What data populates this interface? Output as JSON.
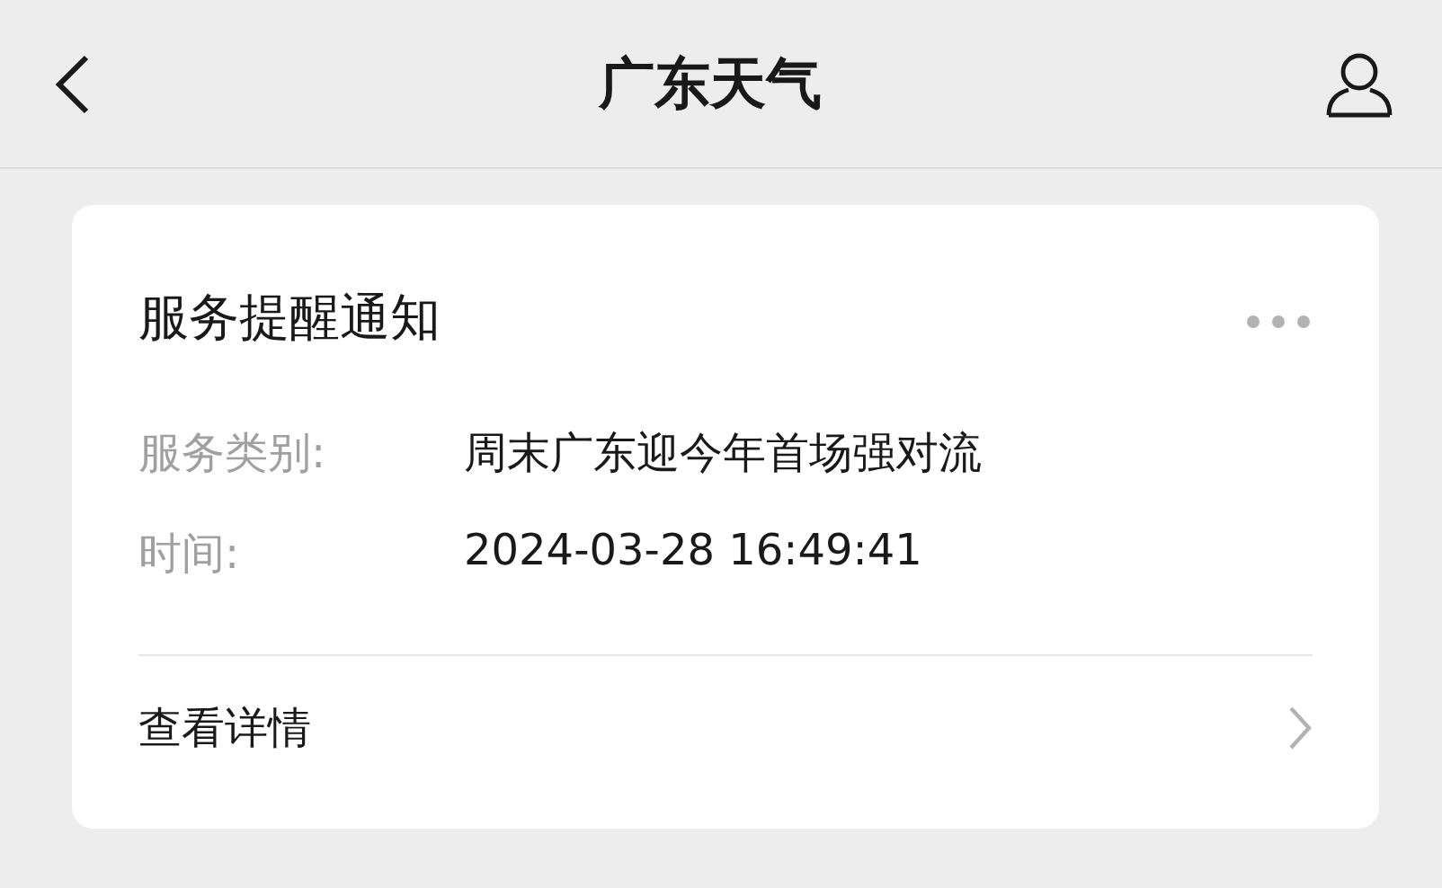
{
  "nav_bar": {
    "title": "广东天气"
  },
  "card": {
    "title": "服务提醒通知",
    "fields": [
      {
        "label": "服务类别:",
        "value": "周末广东迎今年首场强对流"
      },
      {
        "label": "时间:",
        "value": "2024-03-28 16:49:41"
      }
    ],
    "link": "查看详情"
  }
}
